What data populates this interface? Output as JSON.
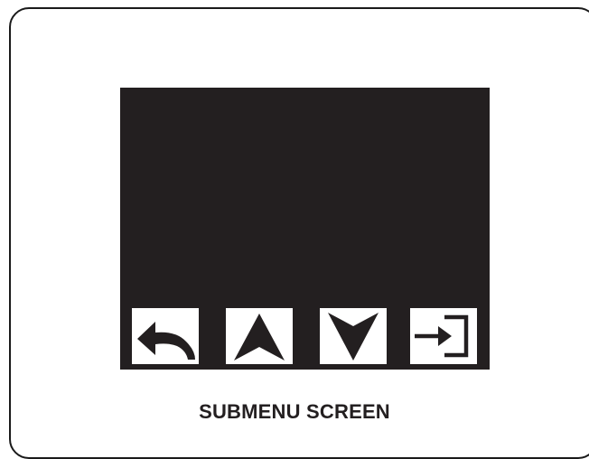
{
  "device": {
    "screen_color": "#231f20",
    "softkeys": [
      {
        "id": "back",
        "icon": "back-arrow-icon"
      },
      {
        "id": "up",
        "icon": "up-arrow-icon"
      },
      {
        "id": "down",
        "icon": "down-arrow-icon"
      },
      {
        "id": "enter",
        "icon": "enter-icon"
      }
    ]
  },
  "caption": {
    "text": "SUBMENU SCREEN"
  }
}
